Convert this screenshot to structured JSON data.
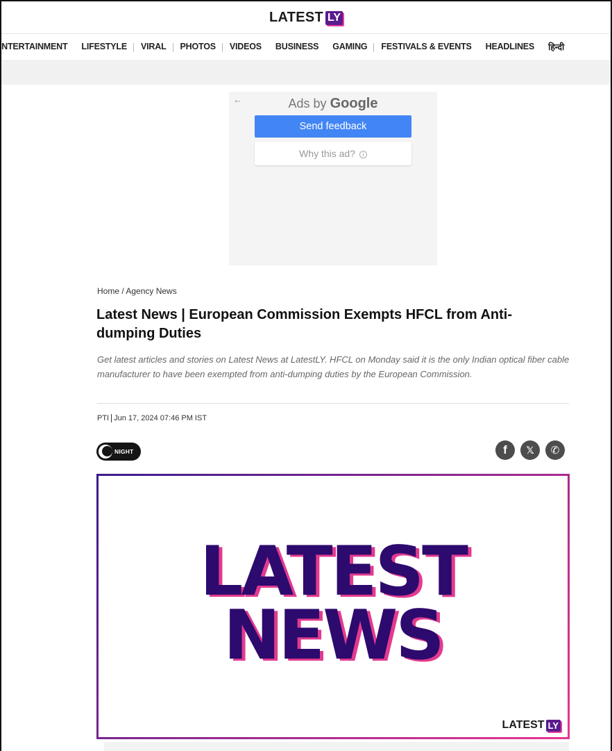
{
  "site": {
    "logo_text": "LATEST",
    "logo_badge": "LY"
  },
  "nav": {
    "items": [
      "ENTERTAINMENT",
      "LIFESTYLE",
      "VIRAL",
      "PHOTOS",
      "VIDEOS",
      "BUSINESS",
      "GAMING",
      "FESTIVALS & EVENTS",
      "HEADLINES",
      "हिन्दी"
    ]
  },
  "ad": {
    "ads_by_prefix": "Ads by",
    "ads_by_brand": "Google",
    "feedback_label": "Send feedback",
    "why_label": "Why this ad?",
    "info_glyph": "i"
  },
  "article": {
    "breadcrumb": "Home / Agency News",
    "headline": "Latest News | European Commission Exempts HFCL from Anti-dumping Duties",
    "summary": "Get latest articles and stories on Latest News at LatestLY. HFCL on Monday said it is the only Indian optical fiber cable manufacturer to have been exempted from anti-dumping duties by the European Commission.",
    "source": "PTI",
    "date": "Jun 17, 2024 07:46 PM IST",
    "night_label": "NIGHT"
  },
  "share": {
    "facebook_glyph": "f",
    "x_glyph": "𝕏",
    "whatsapp_glyph": "✆"
  },
  "hero": {
    "line1": "LATEST",
    "line2": "NEWS",
    "watermark_text": "LATEST",
    "watermark_badge": "LY"
  },
  "colors": {
    "brand_purple": "#2d0a6e",
    "brand_pink": "#e23a8f",
    "google_blue": "#4285f4"
  }
}
